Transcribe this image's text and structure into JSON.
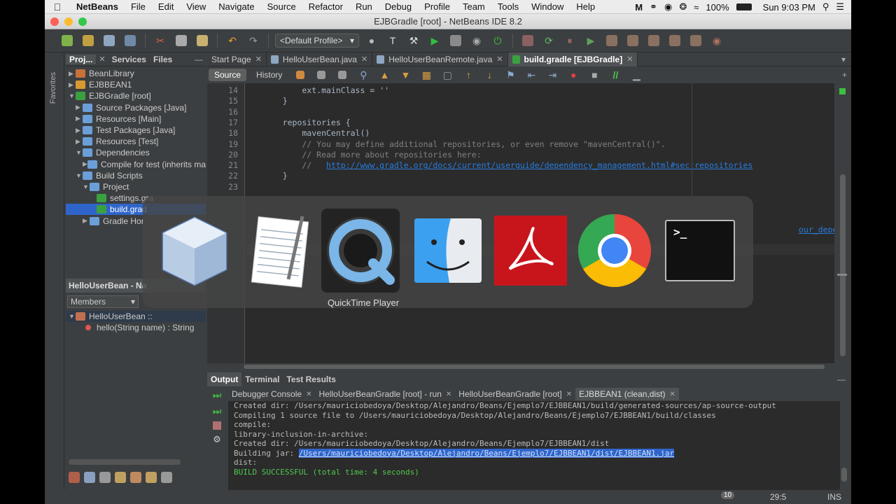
{
  "menubar": {
    "apple": "",
    "items": [
      "NetBeans",
      "File",
      "Edit",
      "View",
      "Navigate",
      "Source",
      "Refactor",
      "Run",
      "Debug",
      "Profile",
      "Team",
      "Tools",
      "Window",
      "Help"
    ],
    "battery": "100%",
    "clock": "Sun 9:03 PM"
  },
  "window": {
    "title": "EJBGradle [root] - NetBeans IDE 8.2"
  },
  "toolbar": {
    "profile": "<Default Profile>"
  },
  "left_strip": {
    "favorites": "Favorites"
  },
  "project_panel": {
    "tabs": [
      "Proj...",
      "Services",
      "Files"
    ],
    "tree": [
      {
        "label": "BeanLibrary",
        "indent": 0,
        "expanded": false,
        "color": "#c87138"
      },
      {
        "label": "EJBBEAN1",
        "indent": 0,
        "expanded": false,
        "color": "#d89a30"
      },
      {
        "label": "EJBGradle [root]",
        "indent": 0,
        "expanded": true,
        "color": "#3aa040"
      },
      {
        "label": "Source Packages [Java]",
        "indent": 1,
        "expanded": false,
        "color": "#6b9fd8"
      },
      {
        "label": "Resources [Main]",
        "indent": 1,
        "expanded": false,
        "color": "#6b9fd8"
      },
      {
        "label": "Test Packages [Java]",
        "indent": 1,
        "expanded": false,
        "color": "#6b9fd8"
      },
      {
        "label": "Resources [Test]",
        "indent": 1,
        "expanded": false,
        "color": "#6b9fd8"
      },
      {
        "label": "Dependencies",
        "indent": 1,
        "expanded": true,
        "color": "#6b9fd8"
      },
      {
        "label": "Compile for test (inherits ma",
        "indent": 2,
        "expanded": false,
        "color": "#6b9fd8"
      },
      {
        "label": "Build Scripts",
        "indent": 1,
        "expanded": true,
        "color": "#6b9fd8"
      },
      {
        "label": "Project",
        "indent": 2,
        "expanded": true,
        "color": "#6b9fd8"
      },
      {
        "label": "settings.gra",
        "indent": 3,
        "expanded": null,
        "color": "#3aa040"
      },
      {
        "label": "build.grad",
        "indent": 3,
        "expanded": null,
        "color": "#3aa040",
        "selected": true
      },
      {
        "label": "Gradle Hor",
        "indent": 2,
        "expanded": false,
        "color": "#6b9fd8"
      }
    ]
  },
  "navigator": {
    "title": "HelloUserBean - Na",
    "filter": "Members",
    "class": "HelloUserBean ::",
    "method_name": "hello",
    "method_params": "(String name)",
    "method_type": ": String"
  },
  "editor_tabs": [
    {
      "label": "Start Page",
      "active": false
    },
    {
      "label": "HelloUserBean.java",
      "active": false
    },
    {
      "label": "HelloUserBeanRemote.java",
      "active": false
    },
    {
      "label": "build.gradle [EJBGradle]",
      "active": true
    }
  ],
  "editor_toolbar": {
    "source": "Source",
    "history": "History"
  },
  "code": [
    {
      "n": "14",
      "parts": [
        {
          "t": "        ext.mainClass = ''",
          "c": "ct"
        }
      ]
    },
    {
      "n": "15",
      "parts": [
        {
          "t": "    }",
          "c": "ct"
        }
      ]
    },
    {
      "n": "16",
      "parts": [
        {
          "t": "",
          "c": "ct"
        }
      ]
    },
    {
      "n": "17",
      "parts": [
        {
          "t": "    repositories {",
          "c": "ct"
        }
      ]
    },
    {
      "n": "18",
      "parts": [
        {
          "t": "        mavenCentral()",
          "c": "ct"
        }
      ]
    },
    {
      "n": "19",
      "parts": [
        {
          "t": "        // You may define additional repositories, or even remove \"mavenCentral()\".",
          "c": "cm"
        }
      ]
    },
    {
      "n": "20",
      "parts": [
        {
          "t": "        // Read more about repositories here:",
          "c": "cm"
        }
      ]
    },
    {
      "n": "21",
      "parts": [
        {
          "t": "        //   ",
          "c": "cm"
        },
        {
          "t": "http://www.gradle.org/docs/current/userguide/dependency_management.html#sec:repositories",
          "c": "lk"
        }
      ]
    },
    {
      "n": "22",
      "parts": [
        {
          "t": "    }",
          "c": "ct"
        }
      ]
    },
    {
      "n": "23",
      "parts": [
        {
          "t": "",
          "c": "ct"
        }
      ]
    }
  ],
  "hidden_link_fragment": "our_dependencies",
  "output": {
    "tabs": [
      "Output",
      "Terminal",
      "Test Results"
    ],
    "subtabs": [
      {
        "label": "Debugger Console",
        "active": false
      },
      {
        "label": "HelloUserBeanGradle [root] - run",
        "active": false
      },
      {
        "label": "HelloUserBeanGradle [root]",
        "active": false
      },
      {
        "label": "EJBBEAN1 (clean,dist)",
        "active": true
      }
    ],
    "lines": [
      {
        "t": "Created dir: /Users/mauriciobedoya/Desktop/Alejandro/Beans/Ejemplo7/EJBBEAN1/build/generated-sources/ap-source-output"
      },
      {
        "t": "Compiling 1 source file to /Users/mauriciobedoya/Desktop/Alejandro/Beans/Ejemplo7/EJBBEAN1/build/classes"
      },
      {
        "t": "compile:"
      },
      {
        "t": "library-inclusion-in-archive:"
      },
      {
        "t": "Created dir: /Users/mauriciobedoya/Desktop/Alejandro/Beans/Ejemplo7/EJBBEAN1/dist"
      },
      {
        "t": "Building jar: ",
        "link": "/Users/mauriciobedoya/Desktop/Alejandro/Beans/Ejemplo7/EJBBEAN1/dist/EJBBEAN1.jar"
      },
      {
        "t": "dist:"
      },
      {
        "t": "BUILD SUCCESSFUL (total time: 4 seconds)",
        "green": true
      }
    ]
  },
  "status": {
    "notifications": "10",
    "position": "29:5",
    "mode": "INS"
  },
  "app_switcher": {
    "apps": [
      "NetBeans",
      "TextEdit",
      "QuickTime Player",
      "Finder",
      "Adobe Acrobat",
      "Google Chrome",
      "Terminal"
    ],
    "selected_label": "QuickTime Player",
    "terminal_prompt": ">_"
  },
  "colors": {
    "ide_bg": "#3c3f41",
    "editor_bg": "#2b2b2b",
    "selection": "#2f65ca",
    "success": "#4ec94e"
  }
}
